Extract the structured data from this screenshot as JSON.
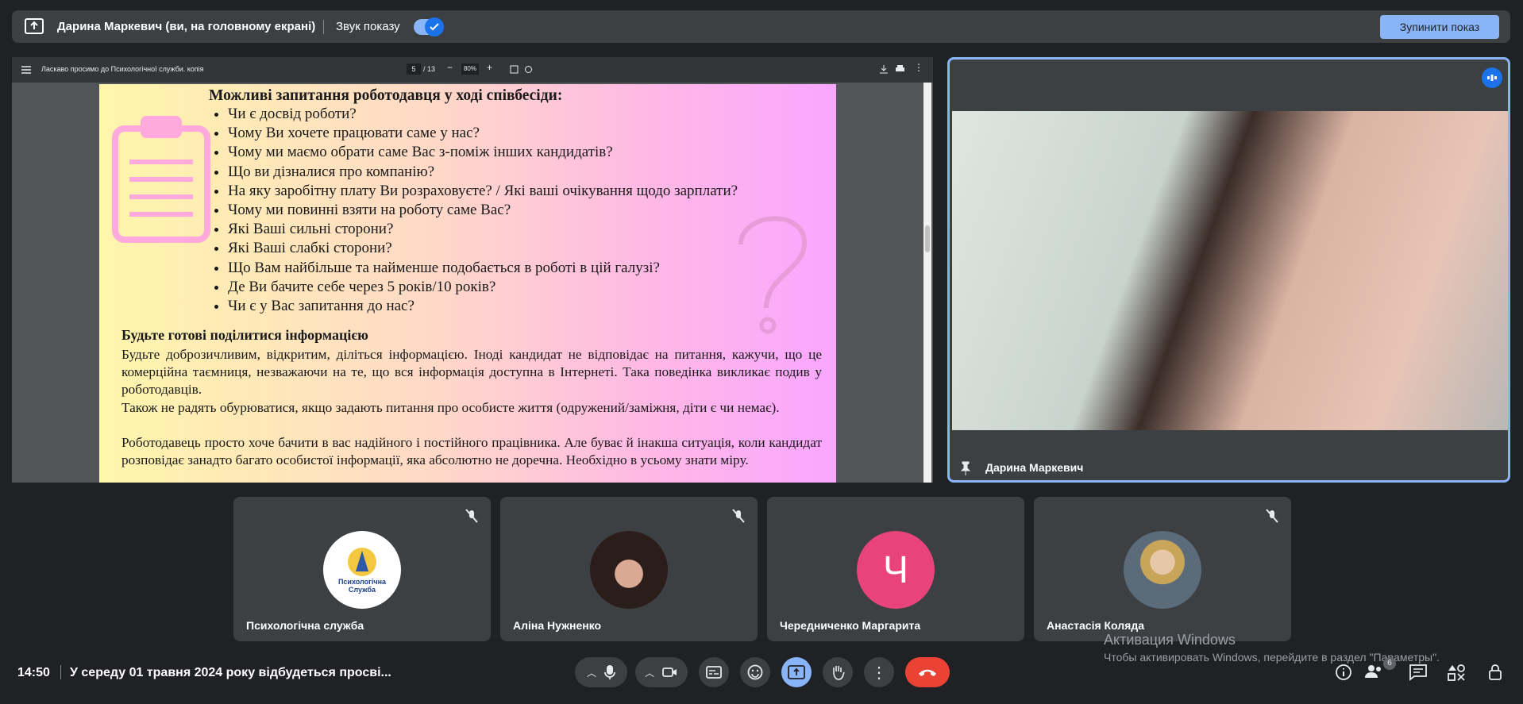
{
  "share_bar": {
    "presenter": "Дарина Маркевич (ви, на головному екрані)",
    "sound_label": "Звук показу",
    "stop_label": "Зупинити показ"
  },
  "pdf": {
    "title": "Ласкаво просимо до Психологічної служби. копія",
    "page_current": "5",
    "page_total": "/ 13",
    "zoom": "80%",
    "heading": "Можливі запитання роботодавця у ході співбесіди:",
    "questions": [
      "Чи є досвід роботи?",
      "Чому Ви хочете працювати саме у нас?",
      "Чому ми маємо обрати саме Вас з-поміж інших кандидатів?",
      "Що ви дізналися про компанію?",
      "На яку заробітну плату Ви розраховуєте? / Які ваші очікування щодо зарплати?",
      "Чому ми повинні взяти на роботу саме Вас?",
      "Які Ваші сильні сторони?",
      "Які Ваші слабкі сторони?",
      "Що Вам найбільше та найменше подобається в роботі в цій галузі?",
      "Де Ви бачите себе через 5 років/10 років?",
      "Чи є у Вас запитання до нас?"
    ],
    "subheading": "Будьте готові поділитися інформацією",
    "para1": "Будьте доброзичливим, відкритим, діліться інформацією. Іноді кандидат не відповідає на питання, кажучи, що це комерційна таємниця, незважаючи на те, що вся інформація доступна в Інтернеті. Така поведінка викликає подив у роботодавців.",
    "para2": "Також не радять обурюватися, якщо задають питання про особисте життя (одружений/заміжня, діти є чи немає).",
    "para3": "Роботодавець просто хоче бачити в вас надійного і постійного працівника. Але буває й інакша ситуація, коли кандидат розповідає занадто багато особистої інформації, яка абсолютно не доречна. Необхідно в усьому знати міру."
  },
  "main_video": {
    "name": "Дарина Маркевич"
  },
  "participants": [
    {
      "name": "Психологічна служба",
      "avatar_text": "Психологічна Служба"
    },
    {
      "name": "Аліна Нужненко"
    },
    {
      "name": "Чередниченко Маргарита",
      "initial": "Ч",
      "color": "#e8437a"
    },
    {
      "name": "Анастасія Коляда"
    }
  ],
  "bottom": {
    "time": "14:50",
    "meeting": "У середу 01 травня 2024 року відбудеться просві...",
    "people_count": "6"
  },
  "watermark": {
    "line1": "Активация Windows",
    "line2": "Чтобы активировать Windows, перейдите в раздел \"Параметры\"."
  }
}
